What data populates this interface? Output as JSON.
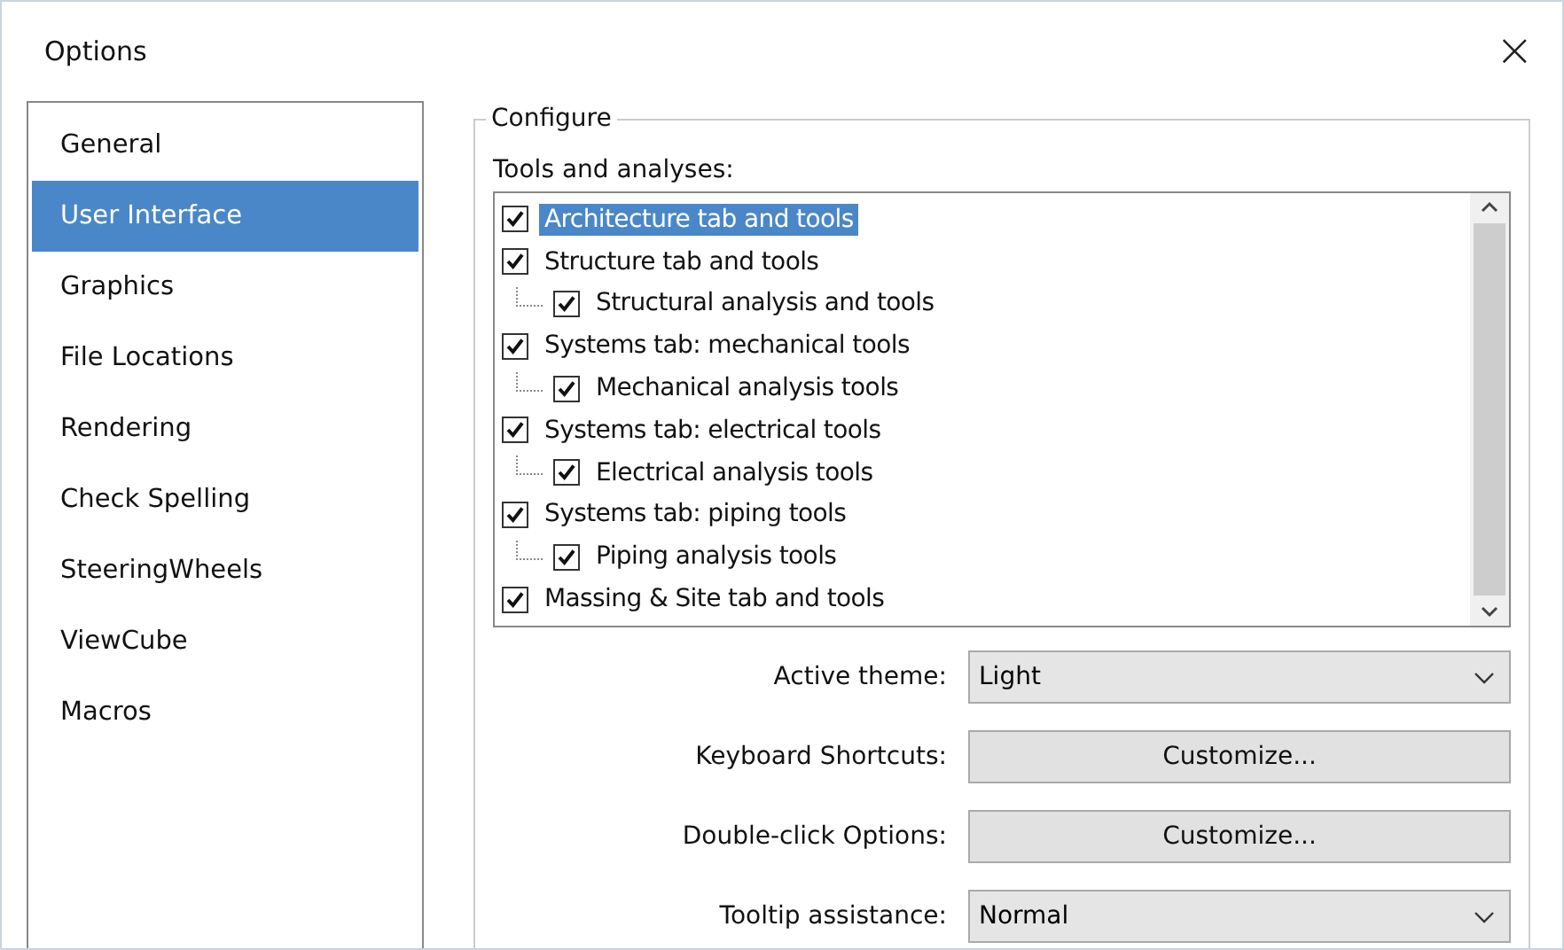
{
  "window": {
    "title": "Options",
    "close": "×"
  },
  "sidebar": {
    "items": [
      {
        "label": "General",
        "selected": false
      },
      {
        "label": "User Interface",
        "selected": true
      },
      {
        "label": "Graphics",
        "selected": false
      },
      {
        "label": "File Locations",
        "selected": false
      },
      {
        "label": "Rendering",
        "selected": false
      },
      {
        "label": "Check Spelling",
        "selected": false
      },
      {
        "label": "SteeringWheels",
        "selected": false
      },
      {
        "label": "ViewCube",
        "selected": false
      },
      {
        "label": "Macros",
        "selected": false
      }
    ]
  },
  "configure": {
    "title": "Configure",
    "list_label": "Tools and analyses:",
    "tools": [
      {
        "label": "Architecture tab and tools",
        "checked": true,
        "selected": true
      },
      {
        "label": "Structure tab and tools",
        "checked": true,
        "selected": false,
        "children": [
          {
            "label": "Structural analysis and tools",
            "checked": true,
            "selected": false
          }
        ]
      },
      {
        "label": "Systems tab: mechanical tools",
        "checked": true,
        "selected": false,
        "children": [
          {
            "label": "Mechanical analysis tools",
            "checked": true,
            "selected": false
          }
        ]
      },
      {
        "label": "Systems tab: electrical tools",
        "checked": true,
        "selected": false,
        "children": [
          {
            "label": "Electrical analysis tools",
            "checked": true,
            "selected": false
          }
        ]
      },
      {
        "label": "Systems tab: piping tools",
        "checked": true,
        "selected": false,
        "children": [
          {
            "label": "Piping analysis tools",
            "checked": true,
            "selected": false
          }
        ]
      },
      {
        "label": "Massing & Site tab and tools",
        "checked": true,
        "selected": false
      }
    ],
    "settings": [
      {
        "kind": "dropdown",
        "label": "Active theme:",
        "value": "Light"
      },
      {
        "kind": "button",
        "label": "Keyboard Shortcuts:",
        "value": "Customize..."
      },
      {
        "kind": "button",
        "label": "Double-click Options:",
        "value": "Customize..."
      },
      {
        "kind": "dropdown",
        "label": "Tooltip assistance:",
        "value": "Normal"
      }
    ]
  }
}
